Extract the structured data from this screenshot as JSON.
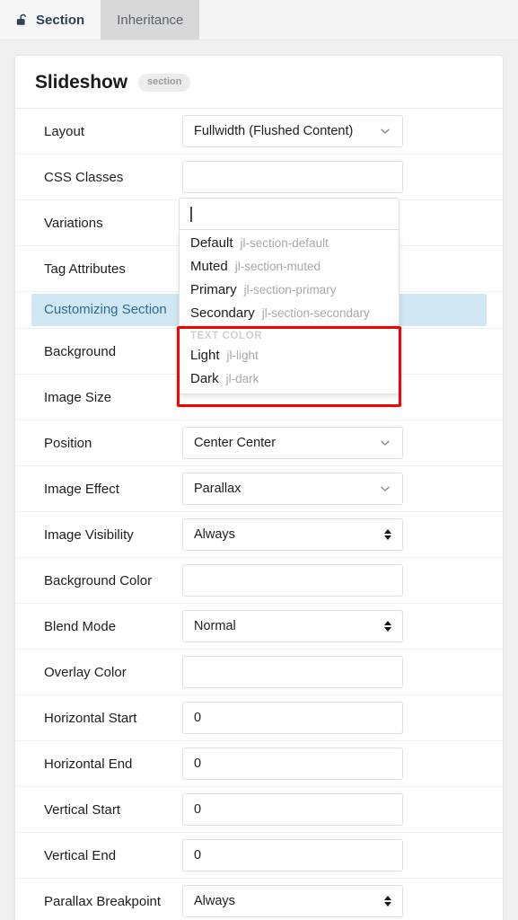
{
  "tabs": [
    {
      "label": "Section",
      "icon": "unlock-icon",
      "active": true
    },
    {
      "label": "Inheritance",
      "active": false
    }
  ],
  "card": {
    "title": "Slideshow",
    "badge": "section"
  },
  "banner": {
    "label": "Customizing Section"
  },
  "combo": {
    "value": "",
    "groups": [
      {
        "header": null,
        "options": [
          {
            "name": "Default",
            "slug": "jl-section-default"
          },
          {
            "name": "Muted",
            "slug": "jl-section-muted"
          },
          {
            "name": "Primary",
            "slug": "jl-section-primary"
          },
          {
            "name": "Secondary",
            "slug": "jl-section-secondary"
          }
        ]
      },
      {
        "header": "TEXT COLOR",
        "options": [
          {
            "name": "Light",
            "slug": "jl-light"
          },
          {
            "name": "Dark",
            "slug": "jl-dark"
          }
        ]
      }
    ]
  },
  "rows": [
    {
      "label": "Layout",
      "value": "Fullwidth (Flushed Content)",
      "control": "select"
    },
    {
      "label": "CSS Classes",
      "value": "",
      "control": "text"
    },
    {
      "label": "Variations",
      "value": "",
      "control": "combo"
    },
    {
      "label": "Tag Attributes",
      "value": "",
      "control": "hidden"
    },
    {
      "label": "Background",
      "value": "",
      "control": "hidden"
    },
    {
      "label": "Image Size",
      "value": "",
      "control": "hidden"
    },
    {
      "label": "Position",
      "value": "Center Center",
      "control": "select"
    },
    {
      "label": "Image Effect",
      "value": "Parallax",
      "control": "select"
    },
    {
      "label": "Image Visibility",
      "value": "Always",
      "control": "stepper"
    },
    {
      "label": "Background Color",
      "value": "",
      "control": "text"
    },
    {
      "label": "Blend Mode",
      "value": "Normal",
      "control": "stepper"
    },
    {
      "label": "Overlay Color",
      "value": "",
      "control": "text"
    },
    {
      "label": "Horizontal Start",
      "value": "0",
      "control": "text"
    },
    {
      "label": "Horizontal End",
      "value": "0",
      "control": "text"
    },
    {
      "label": "Vertical Start",
      "value": "0",
      "control": "text"
    },
    {
      "label": "Vertical End",
      "value": "0",
      "control": "text"
    },
    {
      "label": "Parallax Breakpoint",
      "value": "Always",
      "control": "stepper"
    }
  ],
  "colors": {
    "page_background": "#f0f0f0",
    "tab_active_text": "#2e4455",
    "tab_inactive_background": "#d8d8d8",
    "banner_background": "#cfe8f4",
    "banner_text": "#2b6d8f",
    "annotation_border": "#ff0000",
    "badge_background": "#ececec"
  }
}
